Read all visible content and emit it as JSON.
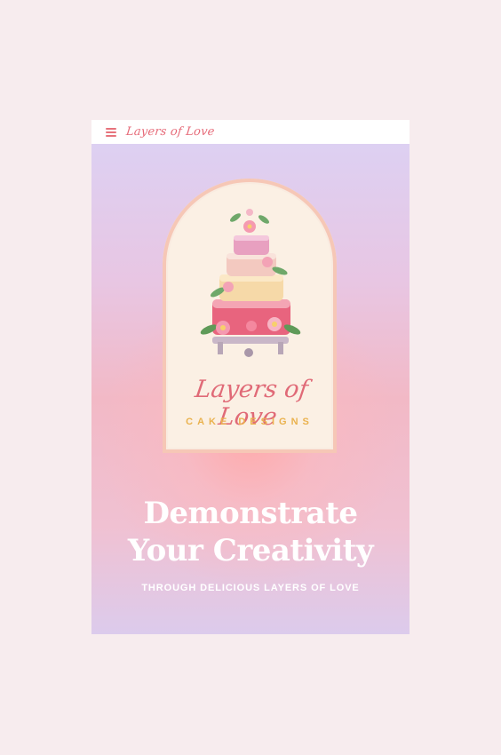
{
  "header": {
    "brand": "Layers of Love",
    "menu_icon": "hamburger-menu-icon"
  },
  "hero": {
    "logo_title": "Layers of Love",
    "logo_subtitle": "CAKE DESIGNS",
    "headline_line1": "Demonstrate",
    "headline_line2": "Your Creativity",
    "subtitle": "THROUGH DELICIOUS LAYERS OF LOVE"
  },
  "colors": {
    "page_background": "#f7ecee",
    "brand_pink": "#e66a78",
    "logo_gold": "#eab24e",
    "arch_fill": "#fbf0e4"
  }
}
